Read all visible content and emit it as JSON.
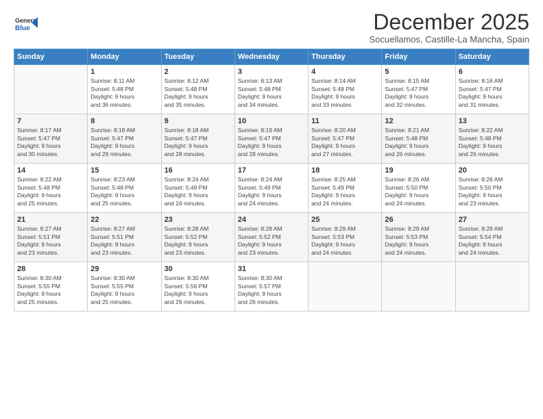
{
  "header": {
    "logo_line1": "General",
    "logo_line2": "Blue",
    "month_title": "December 2025",
    "subtitle": "Socuellamos, Castille-La Mancha, Spain"
  },
  "days_of_week": [
    "Sunday",
    "Monday",
    "Tuesday",
    "Wednesday",
    "Thursday",
    "Friday",
    "Saturday"
  ],
  "weeks": [
    [
      {
        "day": "",
        "info": ""
      },
      {
        "day": "1",
        "info": "Sunrise: 8:11 AM\nSunset: 5:48 PM\nDaylight: 9 hours\nand 36 minutes."
      },
      {
        "day": "2",
        "info": "Sunrise: 8:12 AM\nSunset: 5:48 PM\nDaylight: 9 hours\nand 35 minutes."
      },
      {
        "day": "3",
        "info": "Sunrise: 8:13 AM\nSunset: 5:48 PM\nDaylight: 9 hours\nand 34 minutes."
      },
      {
        "day": "4",
        "info": "Sunrise: 8:14 AM\nSunset: 5:48 PM\nDaylight: 9 hours\nand 33 minutes."
      },
      {
        "day": "5",
        "info": "Sunrise: 8:15 AM\nSunset: 5:47 PM\nDaylight: 9 hours\nand 32 minutes."
      },
      {
        "day": "6",
        "info": "Sunrise: 8:16 AM\nSunset: 5:47 PM\nDaylight: 9 hours\nand 31 minutes."
      }
    ],
    [
      {
        "day": "7",
        "info": "Sunrise: 8:17 AM\nSunset: 5:47 PM\nDaylight: 9 hours\nand 30 minutes."
      },
      {
        "day": "8",
        "info": "Sunrise: 8:18 AM\nSunset: 5:47 PM\nDaylight: 9 hours\nand 29 minutes."
      },
      {
        "day": "9",
        "info": "Sunrise: 8:18 AM\nSunset: 5:47 PM\nDaylight: 9 hours\nand 28 minutes."
      },
      {
        "day": "10",
        "info": "Sunrise: 8:19 AM\nSunset: 5:47 PM\nDaylight: 9 hours\nand 28 minutes."
      },
      {
        "day": "11",
        "info": "Sunrise: 8:20 AM\nSunset: 5:47 PM\nDaylight: 9 hours\nand 27 minutes."
      },
      {
        "day": "12",
        "info": "Sunrise: 8:21 AM\nSunset: 5:48 PM\nDaylight: 9 hours\nand 26 minutes."
      },
      {
        "day": "13",
        "info": "Sunrise: 8:22 AM\nSunset: 5:48 PM\nDaylight: 9 hours\nand 26 minutes."
      }
    ],
    [
      {
        "day": "14",
        "info": "Sunrise: 8:22 AM\nSunset: 5:48 PM\nDaylight: 9 hours\nand 25 minutes."
      },
      {
        "day": "15",
        "info": "Sunrise: 8:23 AM\nSunset: 5:48 PM\nDaylight: 9 hours\nand 25 minutes."
      },
      {
        "day": "16",
        "info": "Sunrise: 8:24 AM\nSunset: 5:49 PM\nDaylight: 9 hours\nand 24 minutes."
      },
      {
        "day": "17",
        "info": "Sunrise: 8:24 AM\nSunset: 5:49 PM\nDaylight: 9 hours\nand 24 minutes."
      },
      {
        "day": "18",
        "info": "Sunrise: 8:25 AM\nSunset: 5:49 PM\nDaylight: 9 hours\nand 24 minutes."
      },
      {
        "day": "19",
        "info": "Sunrise: 8:26 AM\nSunset: 5:50 PM\nDaylight: 9 hours\nand 24 minutes."
      },
      {
        "day": "20",
        "info": "Sunrise: 8:26 AM\nSunset: 5:50 PM\nDaylight: 9 hours\nand 23 minutes."
      }
    ],
    [
      {
        "day": "21",
        "info": "Sunrise: 8:27 AM\nSunset: 5:51 PM\nDaylight: 9 hours\nand 23 minutes."
      },
      {
        "day": "22",
        "info": "Sunrise: 8:27 AM\nSunset: 5:51 PM\nDaylight: 9 hours\nand 23 minutes."
      },
      {
        "day": "23",
        "info": "Sunrise: 8:28 AM\nSunset: 5:52 PM\nDaylight: 9 hours\nand 23 minutes."
      },
      {
        "day": "24",
        "info": "Sunrise: 8:28 AM\nSunset: 5:52 PM\nDaylight: 9 hours\nand 23 minutes."
      },
      {
        "day": "25",
        "info": "Sunrise: 8:29 AM\nSunset: 5:53 PM\nDaylight: 9 hours\nand 24 minutes."
      },
      {
        "day": "26",
        "info": "Sunrise: 8:29 AM\nSunset: 5:53 PM\nDaylight: 9 hours\nand 24 minutes."
      },
      {
        "day": "27",
        "info": "Sunrise: 8:29 AM\nSunset: 5:54 PM\nDaylight: 9 hours\nand 24 minutes."
      }
    ],
    [
      {
        "day": "28",
        "info": "Sunrise: 8:30 AM\nSunset: 5:55 PM\nDaylight: 9 hours\nand 25 minutes."
      },
      {
        "day": "29",
        "info": "Sunrise: 8:30 AM\nSunset: 5:55 PM\nDaylight: 9 hours\nand 25 minutes."
      },
      {
        "day": "30",
        "info": "Sunrise: 8:30 AM\nSunset: 5:56 PM\nDaylight: 9 hours\nand 26 minutes."
      },
      {
        "day": "31",
        "info": "Sunrise: 8:30 AM\nSunset: 5:57 PM\nDaylight: 9 hours\nand 26 minutes."
      },
      {
        "day": "",
        "info": ""
      },
      {
        "day": "",
        "info": ""
      },
      {
        "day": "",
        "info": ""
      }
    ]
  ]
}
